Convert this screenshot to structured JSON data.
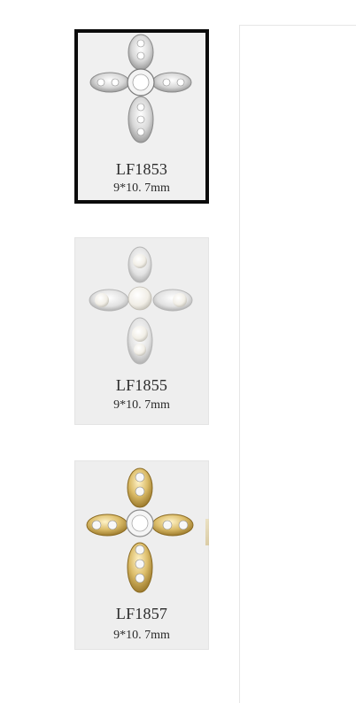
{
  "products": [
    {
      "code": "LF1853",
      "size": "9*10. 7mm",
      "finish": "silver-rhinestone",
      "selected": true
    },
    {
      "code": "LF1855",
      "size": "9*10. 7mm",
      "finish": "silver-pearl",
      "selected": false
    },
    {
      "code": "LF1857",
      "size": "9*10. 7mm",
      "finish": "gold-rhinestone",
      "selected": false
    }
  ],
  "colors": {
    "selected_border": "#0b0b0b",
    "thumb_background": "#eeeeee",
    "gold": "#d4b25a",
    "silver": "#cfcfcf",
    "pearl": "#f6f4ee"
  },
  "icons": {
    "product_image": "cross-charm-icon"
  }
}
